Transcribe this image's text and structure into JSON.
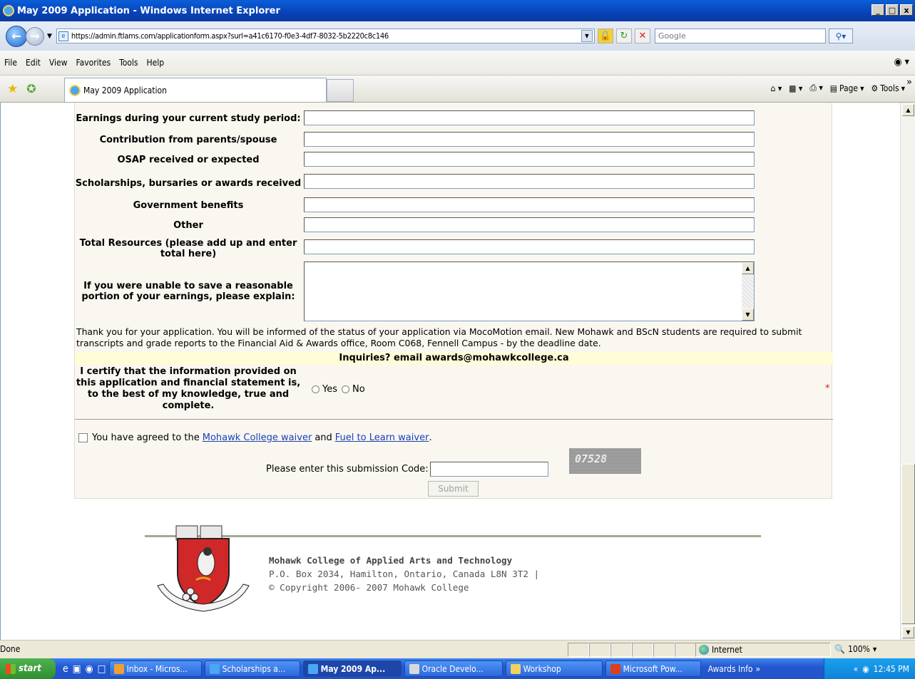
{
  "window": {
    "title": "May 2009 Application - Windows Internet Explorer",
    "min": "_",
    "max": "□",
    "close": "x"
  },
  "address": {
    "url": "https://admin.ftlams.com/applicationform.aspx?surl=a41c6170-f0e3-4df7-8032-5b2220c8c146",
    "search_placeholder": "Google"
  },
  "menu": [
    "File",
    "Edit",
    "View",
    "Favorites",
    "Tools",
    "Help"
  ],
  "tab": {
    "title": "May 2009 Application"
  },
  "commands": {
    "page": "Page",
    "tools": "Tools"
  },
  "form": {
    "rows": [
      {
        "label": "Earnings during your current study period:"
      },
      {
        "label": "Contribution from parents/spouse"
      },
      {
        "label": "OSAP received or expected"
      },
      {
        "label": "Scholarships, bursaries or awards received"
      },
      {
        "label": "Government benefits"
      },
      {
        "label": "Other"
      },
      {
        "label": "Total Resources (please add up and enter total here)"
      }
    ],
    "explain_label": "If you were unable to save a reasonable portion of your earnings, please explain:",
    "thanks": "Thank you for your application. You will be informed of the status of your application via MocoMotion email. New Mohawk and BScN students are required to submit transcripts and grade reports to the Financial Aid & Awards office, Room C068, Fennell Campus - by the deadline date.",
    "inquiries": "Inquiries? email awards@mohawkcollege.ca",
    "certify": "I certify that the information provided on this application and financial statement is, to the best of my knowledge, true and complete.",
    "yes": "Yes",
    "no": "No",
    "required_mark": "*",
    "agree_prefix": "You have agreed to the",
    "agree_link1": "Mohawk College waiver",
    "agree_and": "and",
    "agree_link2": "Fuel to Learn waiver",
    "agree_suffix": ".",
    "code_label": "Please enter this submission Code:",
    "captcha": "07528",
    "submit": "Submit"
  },
  "footer": {
    "name": "Mohawk College of Applied Arts and Technology",
    "address": "P.O. Box 2034, Hamilton, Ontario, Canada L8N 3T2 |",
    "copyright": "© Copyright 2006- 2007 Mohawk College"
  },
  "status": {
    "text": "Done",
    "zone": "Internet",
    "zoom": "100%"
  },
  "taskbar": {
    "start": "start",
    "tasks": [
      {
        "label": "Inbox - Micros...",
        "icon_color": "#f0a030"
      },
      {
        "label": "Scholarships a...",
        "icon_color": "#4aa8f0"
      },
      {
        "label": "May 2009 Ap...",
        "icon_color": "#4aa8f0"
      },
      {
        "label": "Oracle Develo...",
        "icon_color": "#d8d8d8"
      },
      {
        "label": "Workshop",
        "icon_color": "#f0d060"
      },
      {
        "label": "Microsoft Pow...",
        "icon_color": "#d84020"
      },
      {
        "label": "Awards Info",
        "icon_color": ""
      }
    ],
    "clock": "12:45 PM"
  }
}
